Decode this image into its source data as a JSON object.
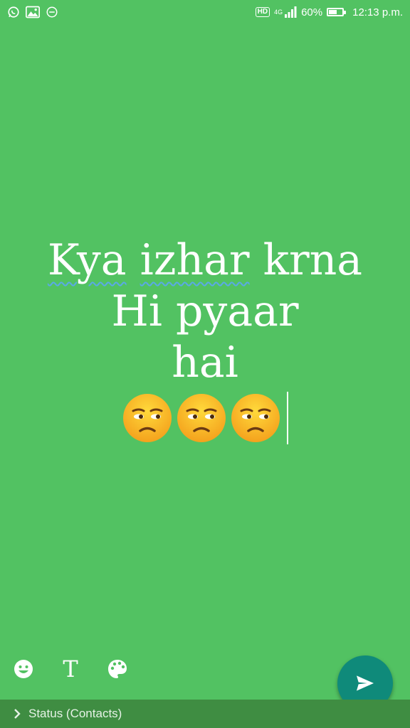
{
  "status_bar": {
    "left_icons": [
      "whatsapp-icon",
      "gallery-icon",
      "minus-circle-icon"
    ],
    "hd_label": "HD",
    "network_label": "4G",
    "battery_percent": "60%",
    "battery_level": 0.6,
    "time": "12:13 p.m."
  },
  "composer": {
    "lines": [
      "Kya izhar krna",
      "Hi pyaar",
      "hai"
    ],
    "squiggle_words": [
      "Kya",
      "izhar"
    ],
    "emoji_count": 3,
    "emoji_name": "unamused-face",
    "background_color": "#52c262"
  },
  "tools": {
    "emoji": "emoji-icon",
    "text_label": "T",
    "palette": "palette-icon"
  },
  "send": {
    "icon": "send-icon",
    "color": "#0f8a7a"
  },
  "footer": {
    "chevron": "chevron-right-icon",
    "audience": "Status (Contacts)"
  }
}
